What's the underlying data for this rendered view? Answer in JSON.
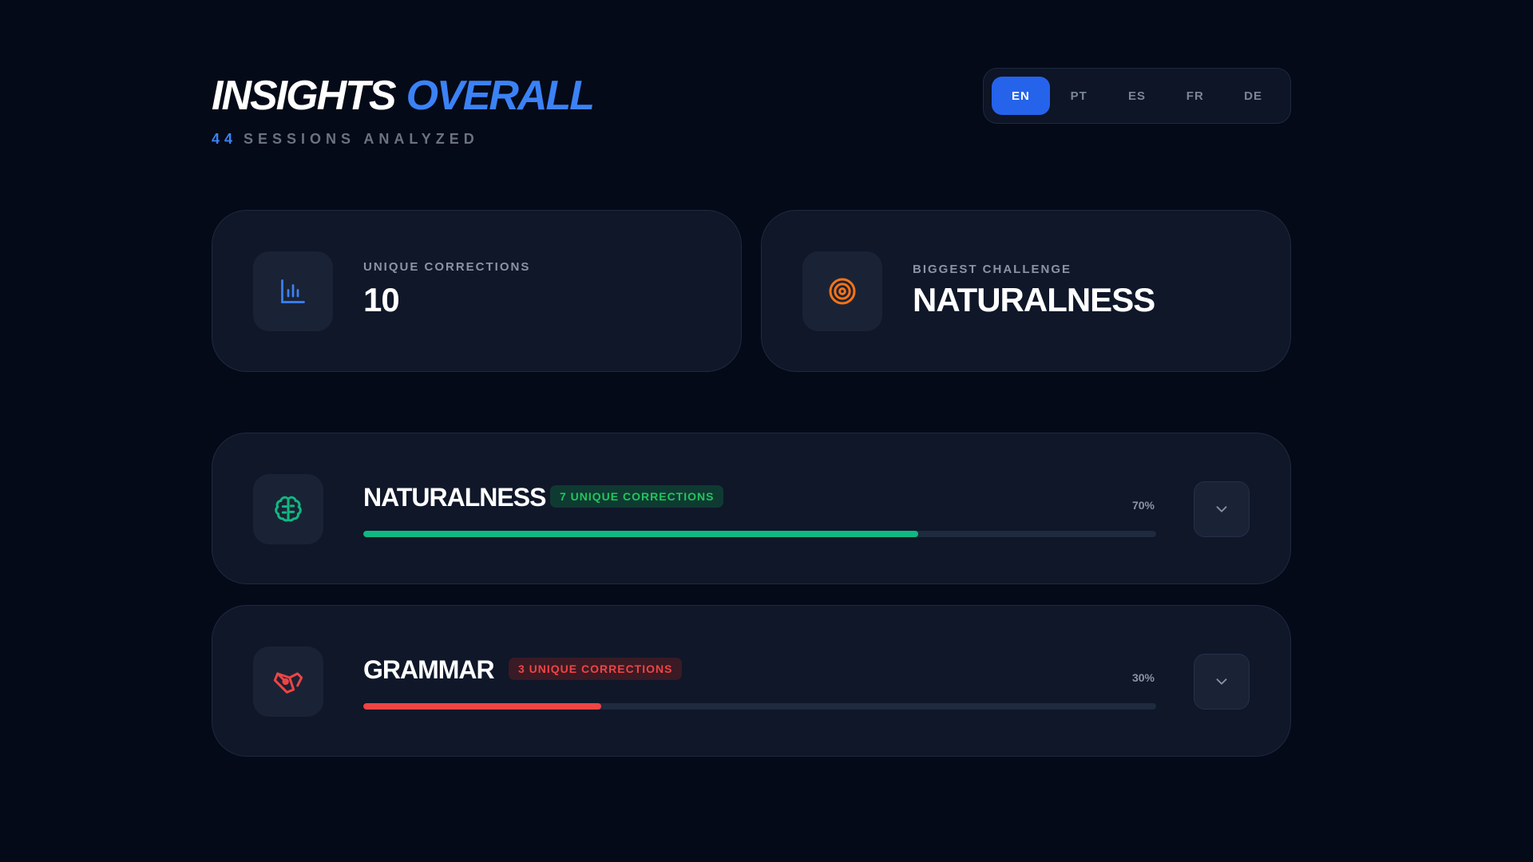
{
  "header": {
    "title_part1": "INSIGHTS",
    "title_part2": "OVERALL",
    "sessions_count": "44",
    "sessions_label": "SESSIONS ANALYZED"
  },
  "languages": [
    {
      "code": "EN",
      "active": true
    },
    {
      "code": "PT",
      "active": false
    },
    {
      "code": "ES",
      "active": false
    },
    {
      "code": "FR",
      "active": false
    },
    {
      "code": "DE",
      "active": false
    }
  ],
  "stats": {
    "unique_corrections": {
      "label": "UNIQUE CORRECTIONS",
      "value": "10",
      "icon": "bar-chart-icon"
    },
    "biggest_challenge": {
      "label": "BIGGEST CHALLENGE",
      "value": "NATURALNESS",
      "icon": "target-icon"
    }
  },
  "categories": [
    {
      "name": "NATURALNESS",
      "badge": "7 UNIQUE CORRECTIONS",
      "percent_label": "70%",
      "percent": 70,
      "icon": "brain-icon",
      "color": "#10b981"
    },
    {
      "name": "GRAMMAR",
      "badge": "3 UNIQUE CORRECTIONS",
      "percent_label": "30%",
      "percent": 30,
      "icon": "pen-nib-icon",
      "color": "#ef4444"
    }
  ],
  "colors": {
    "accent": "#3b82f6",
    "background": "#050a18",
    "card": "#0f1729"
  }
}
